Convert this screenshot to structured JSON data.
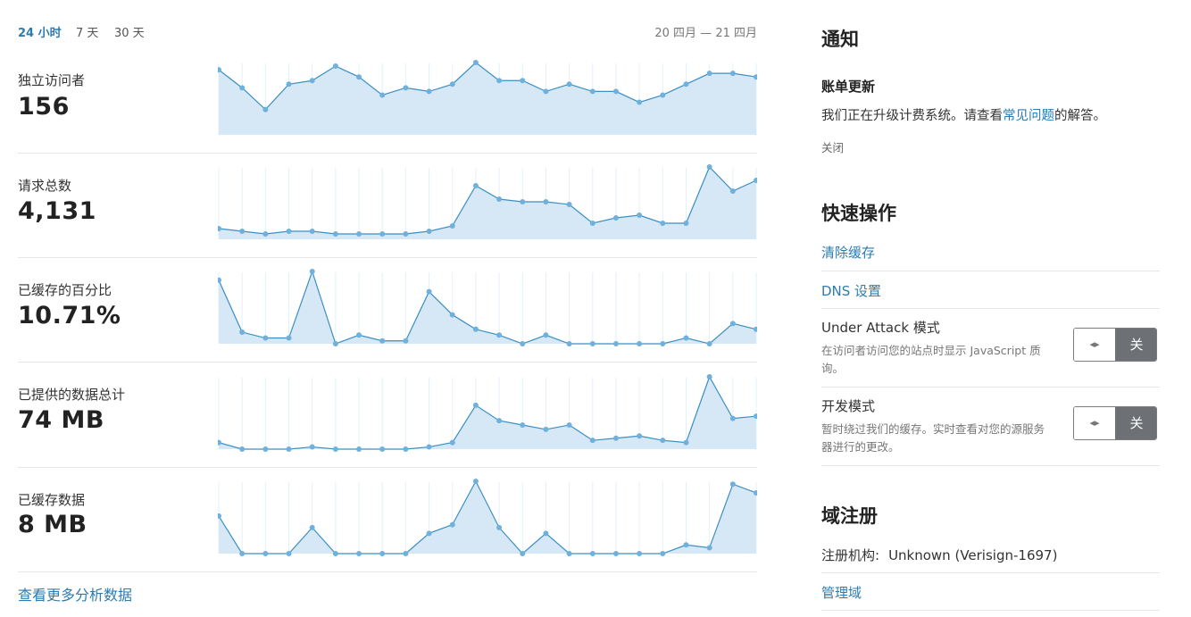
{
  "time_range": {
    "tabs": [
      {
        "label": "24 小时",
        "active": true
      },
      {
        "label": "7 天",
        "active": false
      },
      {
        "label": "30 天",
        "active": false
      }
    ],
    "dates": "20 四月 — 21 四月"
  },
  "colors": {
    "accent": "#2c7cb0",
    "line": "#3a8fc4",
    "fill": "#d6e8f5",
    "marker": "#6fb0dd",
    "grid": "#e3f0f8"
  },
  "metrics": [
    {
      "label": "独立访问者",
      "value": "156"
    },
    {
      "label": "请求总数",
      "value": "4,131"
    },
    {
      "label": "已缓存的百分比",
      "value": "10.71%"
    },
    {
      "label": "已提供的数据总计",
      "value": "74 MB"
    },
    {
      "label": "已缓存数据",
      "value": "8 MB"
    }
  ],
  "chart_data": [
    {
      "type": "area",
      "series": [
        {
          "values": [
            18,
            13,
            7,
            14,
            15,
            19,
            16,
            11,
            13,
            12,
            14,
            20,
            15,
            15,
            12,
            14,
            12,
            12,
            9,
            11,
            14,
            17,
            17,
            16
          ]
        }
      ]
    },
    {
      "type": "area",
      "series": [
        {
          "values": [
            4,
            3,
            2,
            3,
            3,
            2,
            2,
            2,
            2,
            3,
            5,
            20,
            15,
            14,
            14,
            13,
            6,
            8,
            9,
            6,
            6,
            27,
            18,
            22
          ]
        }
      ]
    },
    {
      "type": "area",
      "series": [
        {
          "values": [
            22,
            4,
            2,
            2,
            25,
            0,
            3,
            1,
            1,
            18,
            10,
            5,
            3,
            0,
            3,
            0,
            0,
            0,
            0,
            0,
            2,
            0,
            7,
            5
          ]
        }
      ]
    },
    {
      "type": "area",
      "series": [
        {
          "values": [
            3,
            0,
            0,
            0,
            1,
            0,
            0,
            0,
            0,
            1,
            3,
            20,
            13,
            11,
            9,
            11,
            4,
            5,
            6,
            4,
            3,
            33,
            14,
            15
          ]
        }
      ]
    },
    {
      "type": "area",
      "series": [
        {
          "values": [
            13,
            0,
            0,
            0,
            9,
            0,
            0,
            0,
            0,
            7,
            10,
            25,
            9,
            0,
            7,
            0,
            0,
            0,
            0,
            0,
            3,
            2,
            24,
            21
          ]
        }
      ]
    }
  ],
  "more_link": "查看更多分析数据",
  "notifications": {
    "title": "通知",
    "item_title": "账单更新",
    "text_before": "我们正在升级计费系统。请查看",
    "link_text": "常见问题",
    "text_after": "的解答。",
    "dismiss": "关闭"
  },
  "quick_actions": {
    "title": "快速操作",
    "purge_cache": "清除缓存",
    "dns_settings": "DNS 设置",
    "under_attack": {
      "title": "Under Attack 模式",
      "description": "在访问者访问您的站点时显示 JavaScript 质询。",
      "handle": "◂▸",
      "state": "关"
    },
    "dev_mode": {
      "title": "开发模式",
      "description": "暂时绕过我们的缓存。实时查看对您的源服务器进行的更改。",
      "handle": "◂▸",
      "state": "关"
    }
  },
  "domain_registration": {
    "title": "域注册",
    "registrar_label": "注册机构:",
    "registrar_value": "Unknown (Verisign-1697)",
    "manage": "管理域"
  }
}
